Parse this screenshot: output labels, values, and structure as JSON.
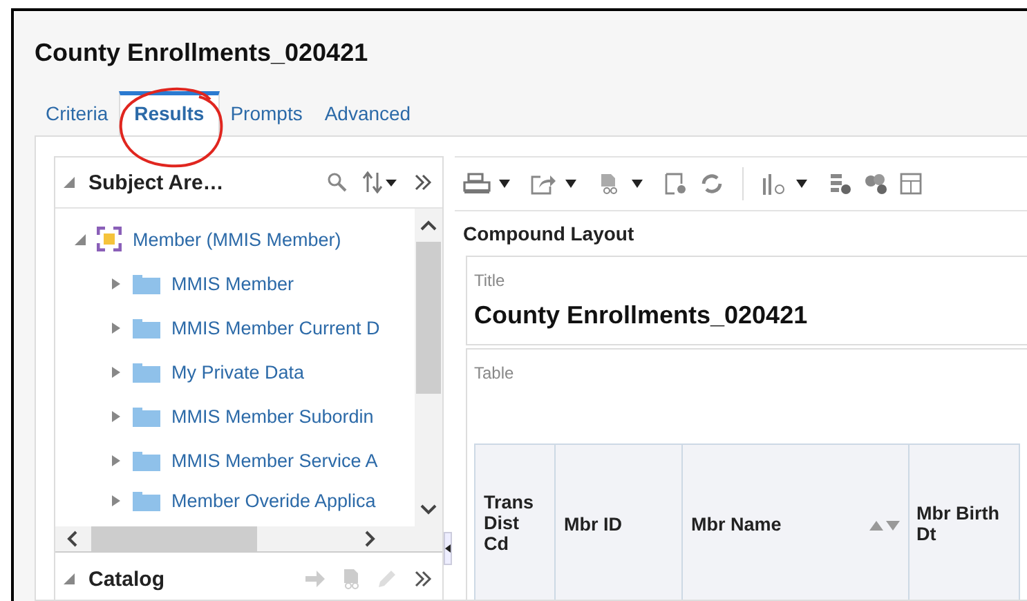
{
  "window": {
    "title": "County Enrollments_020421"
  },
  "tabs": [
    {
      "label": "Criteria",
      "selected": false
    },
    {
      "label": "Results",
      "selected": true,
      "annotated": true
    },
    {
      "label": "Prompts",
      "selected": false
    },
    {
      "label": "Advanced",
      "selected": false
    }
  ],
  "subject_areas": {
    "title": "Subject Are…",
    "tree": [
      {
        "label": "Member (MMIS Member)",
        "kind": "subject",
        "expanded": true,
        "children": [
          {
            "label": "MMIS Member",
            "kind": "folder",
            "expanded": false
          },
          {
            "label": "MMIS Member Current D",
            "kind": "folder",
            "expanded": false
          },
          {
            "label": "My Private Data",
            "kind": "folder",
            "expanded": false
          },
          {
            "label": "MMIS Member Subordin",
            "kind": "folder",
            "expanded": false
          },
          {
            "label": "MMIS Member Service A",
            "kind": "folder",
            "expanded": false
          },
          {
            "label": "Member Overide Applica",
            "kind": "folder",
            "expanded": false
          }
        ]
      }
    ]
  },
  "catalog": {
    "title": "Catalog"
  },
  "layout": {
    "title": "Compound Layout",
    "views": [
      {
        "kind": "title",
        "label": "Title",
        "value": "County Enrollments_020421"
      },
      {
        "kind": "table",
        "label": "Table",
        "columns": [
          {
            "label": "Trans Dist Cd",
            "sortable": false
          },
          {
            "label": "Mbr ID",
            "sortable": false
          },
          {
            "label": "Mbr Name",
            "sortable": true
          },
          {
            "label": "Mbr Birth Dt",
            "sortable": false
          }
        ]
      }
    ]
  }
}
